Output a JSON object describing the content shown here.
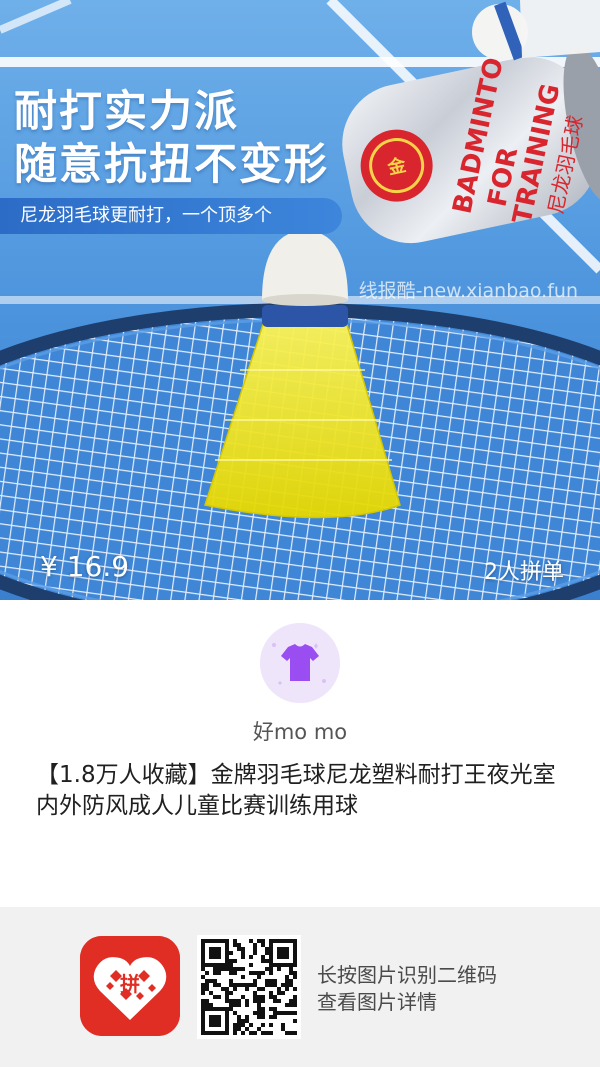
{
  "product_image": {
    "headline_line1": "耐打实力派",
    "headline_line2": "随意抗扭不变形",
    "tagline": "尼龙羽毛球更耐打，一个顶多个",
    "tube_text_1": "BADMINTO",
    "tube_text_2": "FOR",
    "tube_text_3": "TRAINING",
    "tube_text_cn": "尼龙羽毛球",
    "watermark": "线报酷-new.xianbao.fun",
    "price": "¥ 16.9",
    "group_buy": "2人拼单",
    "colors": {
      "background": "#4f97df",
      "shuttle": "#f5ea12",
      "tube_logo": "#d9252e"
    }
  },
  "shop": {
    "avatar_icon": "tshirt-icon",
    "name": "好mo mo"
  },
  "product": {
    "title": "【1.8万人收藏】金牌羽毛球尼龙塑料耐打王夜光室内外防风成人儿童比赛训练用球"
  },
  "footer": {
    "app_icon": "pinduoduo-logo-icon",
    "app_logo_char": "拼",
    "qr_icon": "qr-code-icon",
    "hint_line1": "长按图片识别二维码",
    "hint_line2": "查看图片详情"
  }
}
